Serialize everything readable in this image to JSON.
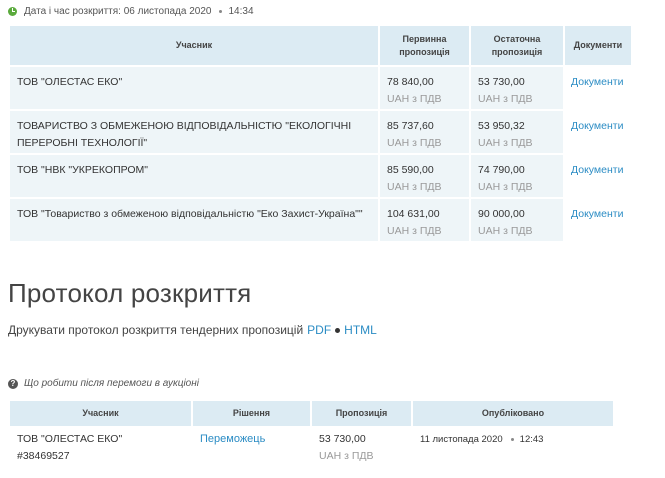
{
  "disclosure": {
    "label": "Дата і час розкриття: 06 листопада 2020",
    "time": "14:34"
  },
  "bids_table": {
    "headers": {
      "participant": "Учасник",
      "initial": "Первинна пропозиція",
      "final": "Остаточна пропозиція",
      "documents": "Документи"
    },
    "rows": [
      {
        "name": "ТОВ \"ОЛЕСТАС ЕКО\"",
        "initial": "78 840,00",
        "final": "53 730,00",
        "vat": "UAH з ПДВ",
        "docs": "Документи"
      },
      {
        "name": "ТОВАРИСТВО З ОБМЕЖЕНОЮ ВІДПОВІДАЛЬНІСТЮ \"ЕКОЛОГІЧНІ ПЕРЕРОБНІ ТЕХНОЛОГІЇ\"",
        "initial": "85 737,60",
        "final": "53 950,32",
        "vat": "UAH з ПДВ",
        "docs": "Документи"
      },
      {
        "name": "ТОВ \"НВК \"УКРЕКОПРОМ\"",
        "initial": "85 590,00",
        "final": "74 790,00",
        "vat": "UAH з ПДВ",
        "docs": "Документи"
      },
      {
        "name": "ТОВ \"Товариство з обмеженою відповідальністю \"Еко Захист-Україна\"\"",
        "initial": "104 631,00",
        "final": "90 000,00",
        "vat": "UAH з ПДВ",
        "docs": "Документи"
      }
    ]
  },
  "protocol": {
    "title": "Протокол розкриття",
    "print_text": "Друкувати протокол розкриття тендерних пропозицій",
    "pdf": "PDF",
    "html": "HTML"
  },
  "hint": {
    "icon": "question-icon",
    "text": "Що робити після перемоги в аукціоні"
  },
  "winner_table": {
    "headers": {
      "participant": "Учасник",
      "decision": "Рішення",
      "offer": "Пропозиція",
      "published": "Опубліковано"
    },
    "row": {
      "name": "ТОВ \"ОЛЕСТАС ЕКО\"",
      "code": "#38469527",
      "decision": "Переможець",
      "offer": "53 730,00",
      "vat": "UAH з ПДВ",
      "date": "11 листопада 2020",
      "time": "12:43"
    }
  },
  "colors": {
    "link": "#2b8cc4",
    "header_bg": "#dcebf3",
    "cell_bg": "#eef5f8",
    "clock_icon": "#5aaa3c"
  }
}
